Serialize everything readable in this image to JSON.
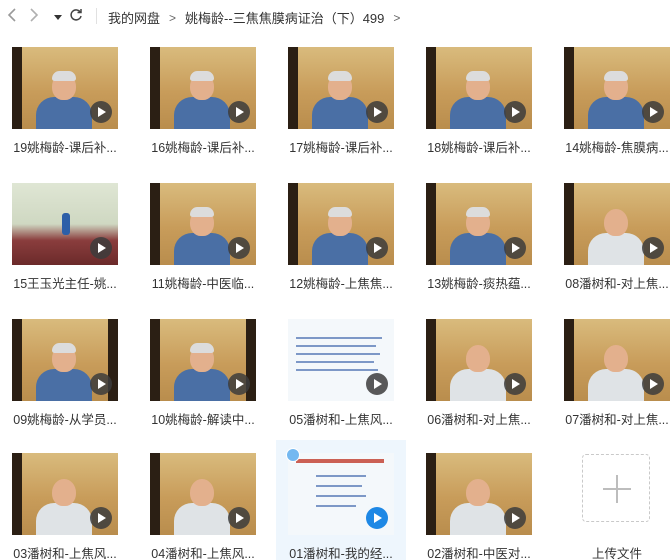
{
  "toolbar": {
    "back_icon": "chevron-left-icon",
    "forward_icon": "chevron-right-icon",
    "history_icon": "caret-down-icon",
    "refresh_icon": "refresh-icon"
  },
  "breadcrumb": {
    "root": "我的网盘",
    "separator": ">",
    "current": "姚梅龄--三焦焦膜病证治（下）499",
    "trailing": ">"
  },
  "files": [
    {
      "name": "19姚梅龄-课后补..."
    },
    {
      "name": "16姚梅龄-课后补..."
    },
    {
      "name": "17姚梅龄-课后补..."
    },
    {
      "name": "18姚梅龄-课后补..."
    },
    {
      "name": "14姚梅龄-焦膜病..."
    },
    {
      "name": "15王玉光主任-姚..."
    },
    {
      "name": "11姚梅龄-中医临..."
    },
    {
      "name": "12姚梅龄-上焦焦..."
    },
    {
      "name": "13姚梅龄-痰热蕴..."
    },
    {
      "name": "08潘树和-对上焦..."
    },
    {
      "name": "09姚梅龄-从学员..."
    },
    {
      "name": "10姚梅龄-解读中..."
    },
    {
      "name": "05潘树和-上焦风..."
    },
    {
      "name": "06潘树和-对上焦..."
    },
    {
      "name": "07潘树和-对上焦..."
    },
    {
      "name": "03潘树和-上焦风..."
    },
    {
      "name": "04潘树和-上焦风..."
    },
    {
      "name": "01潘树和-我的经..."
    },
    {
      "name": "02潘树和-中医对..."
    }
  ],
  "upload": {
    "label": "上传文件"
  },
  "colors": {
    "accent": "#1e88e5",
    "selected_bg": "#eef6fd"
  }
}
